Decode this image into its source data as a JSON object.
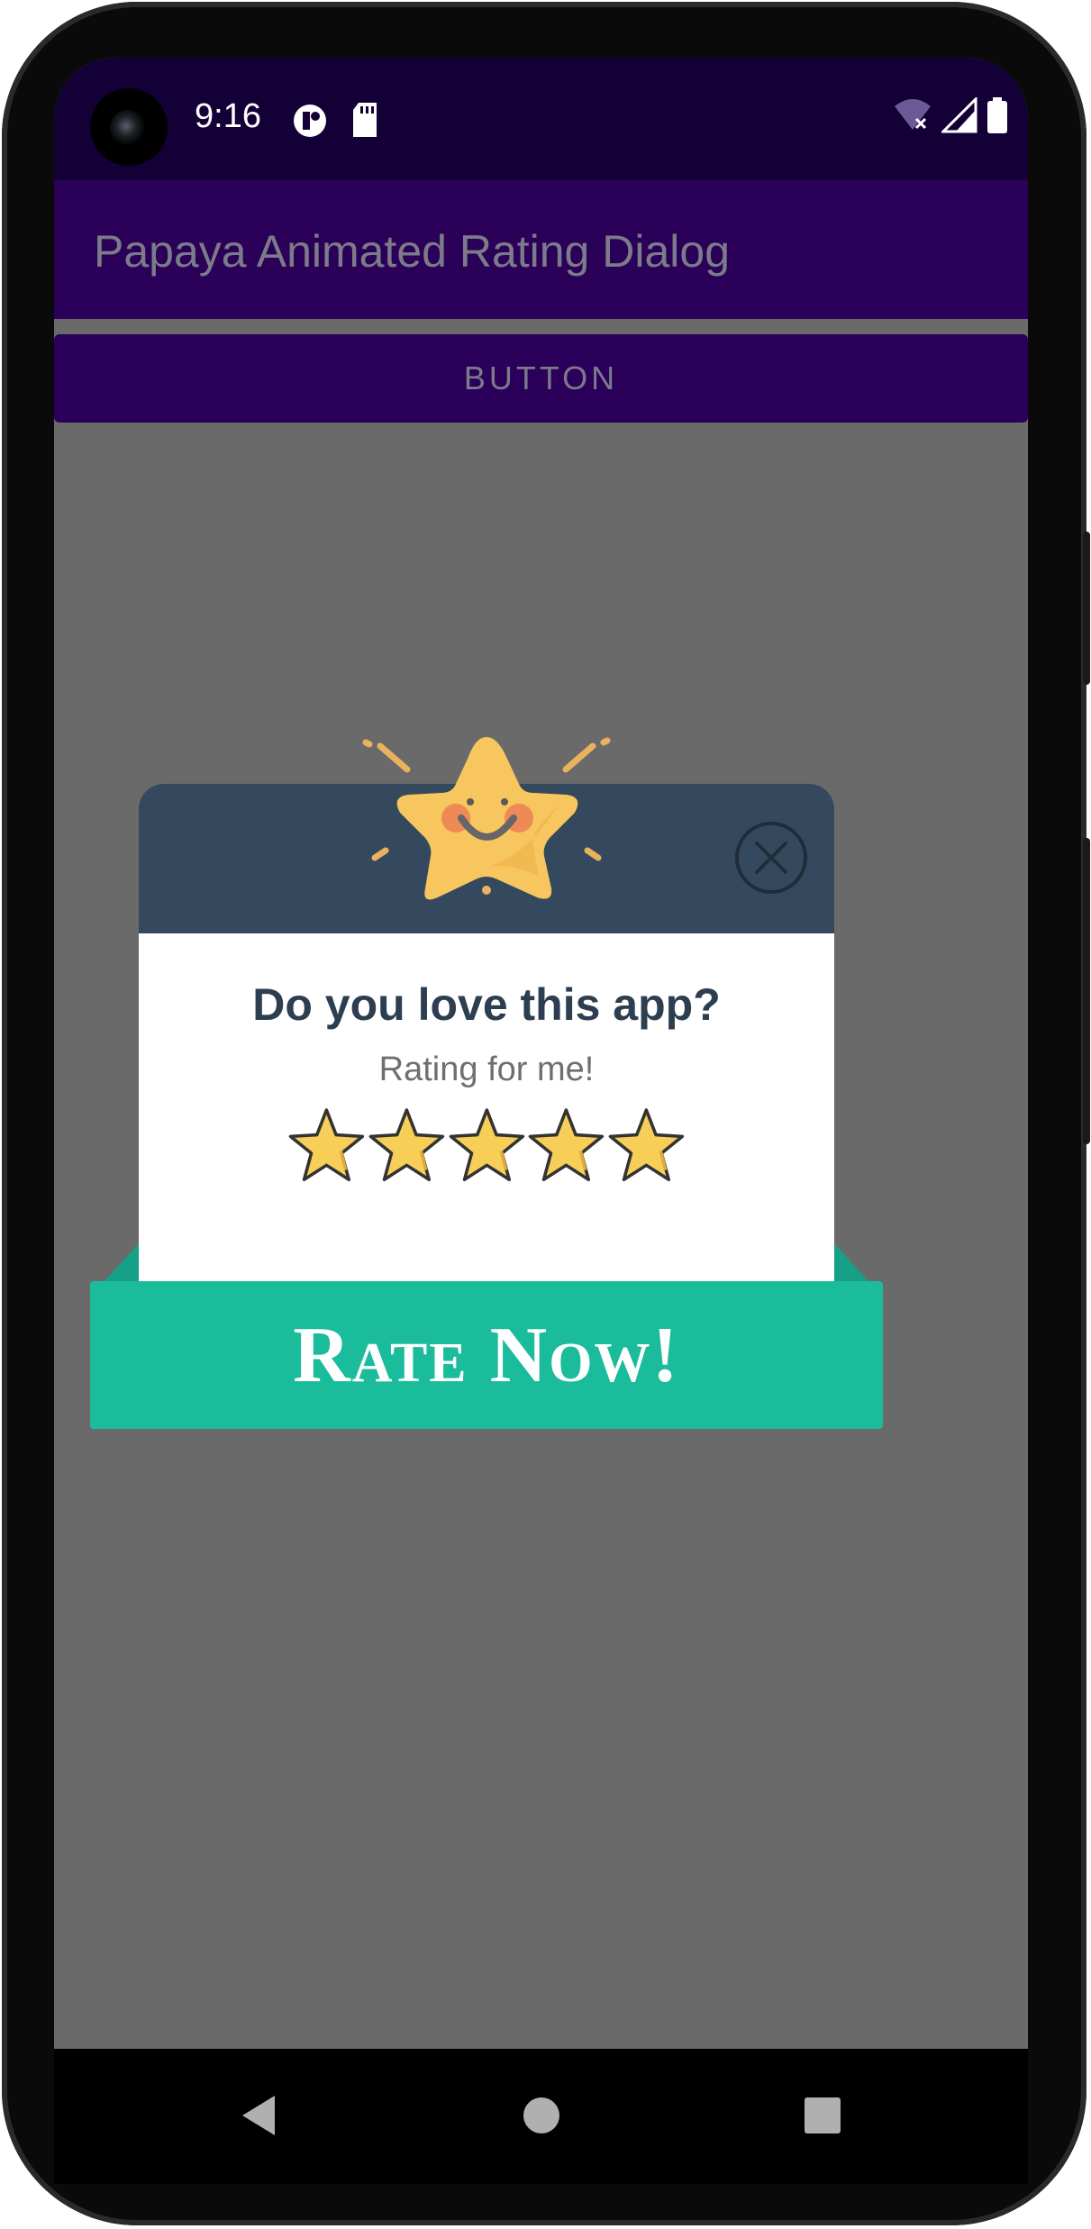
{
  "status_bar": {
    "time": "9:16",
    "icons_left": [
      "notification-icon",
      "sd-card-icon"
    ],
    "icons_right": [
      "wifi-icon",
      "signal-icon",
      "battery-icon"
    ]
  },
  "app_bar": {
    "title": "Papaya Animated Rating Dialog"
  },
  "main_button": {
    "label": "BUTTON"
  },
  "dialog": {
    "title": "Do you love this app?",
    "subtitle": "Rating for me!",
    "stars": [
      "star-1",
      "star-2",
      "star-3",
      "star-4",
      "star-5"
    ],
    "rate_button_label": "Rate Now!",
    "close_icon": "close-icon",
    "mascot_icon": "smiling-star-icon"
  },
  "nav_bar": {
    "items": [
      "back-icon",
      "home-icon",
      "recents-icon"
    ]
  },
  "colors": {
    "status_bar": "#130036",
    "app_bar": "#2b0059",
    "dialog_header": "#34495e",
    "rate_button": "#1abc9c",
    "star_fill": "#f7cf58",
    "overlay": "#6a6a6a"
  }
}
